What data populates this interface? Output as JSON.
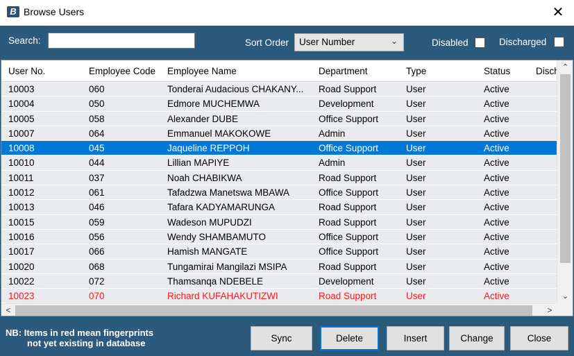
{
  "window": {
    "title": "Browse Users",
    "close_glyph": "✕",
    "app_icon_glyph": "B"
  },
  "toolbar": {
    "search_label": "Search:",
    "search_value": "",
    "sort_label": "Sort Order",
    "sort_value": "User Number",
    "disabled_label": "Disabled",
    "disabled_checked": false,
    "discharged_label": "Discharged",
    "discharged_checked": false
  },
  "grid": {
    "columns": [
      "User No.",
      "Employee Code",
      "Employee Name",
      "Department",
      "Type",
      "Status",
      "Disch"
    ],
    "rows": [
      {
        "cells": [
          "10003",
          "060",
          "Tonderai Audacious CHAKANY...",
          "Road Support",
          "User",
          "Active",
          ""
        ],
        "state": "normal"
      },
      {
        "cells": [
          "10004",
          "050",
          "Edmore  MUCHEMWA",
          "Development",
          "User",
          "Active",
          ""
        ],
        "state": "normal"
      },
      {
        "cells": [
          "10005",
          "058",
          "Alexander  DUBE",
          "Office Support",
          "User",
          "Active",
          ""
        ],
        "state": "normal"
      },
      {
        "cells": [
          "10007",
          "064",
          "Emmanuel  MAKOKOWE",
          "Admin",
          "User",
          "Active",
          ""
        ],
        "state": "normal"
      },
      {
        "cells": [
          "10008",
          "045",
          "Jaqueline  REPPOH",
          "Office Support",
          "User",
          "Active",
          ""
        ],
        "state": "selected"
      },
      {
        "cells": [
          "10010",
          "044",
          "Lillian  MAPIYE",
          "Admin",
          "User",
          "Active",
          ""
        ],
        "state": "normal"
      },
      {
        "cells": [
          "10011",
          "037",
          "Noah  CHABIKWA",
          "Road Support",
          "User",
          "Active",
          ""
        ],
        "state": "normal"
      },
      {
        "cells": [
          "10012",
          "061",
          "Tafadzwa Manetswa MBAWA",
          "Office Support",
          "User",
          "Active",
          ""
        ],
        "state": "normal"
      },
      {
        "cells": [
          "10013",
          "046",
          "Tafara  KADYAMARUNGA",
          "Road Support",
          "User",
          "Active",
          ""
        ],
        "state": "normal"
      },
      {
        "cells": [
          "10015",
          "059",
          "Wadeson  MUPUDZI",
          "Road Support",
          "User",
          "Active",
          ""
        ],
        "state": "normal"
      },
      {
        "cells": [
          "10016",
          "056",
          "Wendy  SHAMBAMUTO",
          "Office Support",
          "User",
          "Active",
          ""
        ],
        "state": "normal"
      },
      {
        "cells": [
          "10017",
          "066",
          "Hamish  MANGATE",
          "Office Support",
          "User",
          "Active",
          ""
        ],
        "state": "normal"
      },
      {
        "cells": [
          "10020",
          "068",
          "Tungamirai Mangilazi MSIPA",
          "Road Support",
          "User",
          "Active",
          ""
        ],
        "state": "normal"
      },
      {
        "cells": [
          "10022",
          "072",
          "Thamsanqa  NDEBELE",
          "Development",
          "User",
          "Active",
          ""
        ],
        "state": "normal"
      },
      {
        "cells": [
          "10023",
          "070",
          "Richard  KUFAHAKUTIZWI",
          "Road Support",
          "User",
          "Active",
          ""
        ],
        "state": "red"
      }
    ]
  },
  "scrollbars": {
    "up_glyph": "⌃",
    "down_glyph": "⌄",
    "left_glyph": "<",
    "right_glyph": ">"
  },
  "footer": {
    "note_line1": "NB: Items in red mean fingerprints",
    "note_line2": "not yet existing in database",
    "buttons": {
      "sync": "Sync",
      "delete": "Delete",
      "insert": "Insert",
      "change": "Change",
      "close": "Close"
    }
  },
  "colors": {
    "panel": "#2c5a7d",
    "selection": "#0078d7",
    "row_background": "#e9ebee",
    "missing_fingerprint_text": "#ff1a1a"
  }
}
